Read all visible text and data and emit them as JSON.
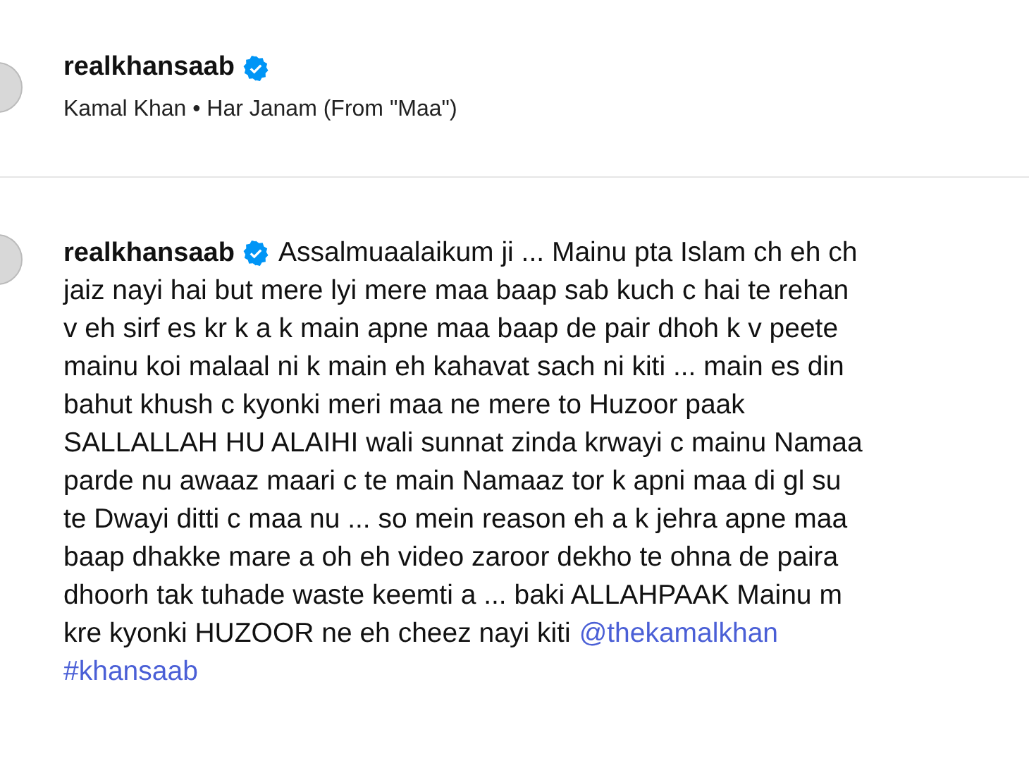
{
  "header": {
    "username": "realkhansaab",
    "verified": true,
    "audio": "Kamal Khan • Har Janam (From \"Maa\")"
  },
  "caption": {
    "username": "realkhansaab",
    "verified": true,
    "lines": [
      "Assalmuaalaikum ji ... Mainu pta Islam ch eh ch",
      "jaiz nayi hai but mere lyi mere maa baap sab kuch c hai te rehan",
      "v eh sirf es kr k a k main apne maa baap de pair dhoh k v peete",
      "mainu koi malaal ni k main eh kahavat sach ni kiti ... main es din",
      "bahut khush c kyonki meri maa ne mere to Huzoor paak",
      "SALLALLAH HU ALAIHI wali sunnat zinda krwayi c mainu Namaa",
      "parde nu awaaz maari c te main Namaaz tor k apni maa di gl su",
      "te Dwayi ditti c maa nu ... so mein reason eh a k jehra apne maa",
      "baap dhakke mare a oh eh video zaroor dekho te ohna de paira",
      "dhoorh tak tuhade waste keemti a ... baki ALLAHPAAK Mainu m",
      "kre kyonki HUZOOR ne eh cheez nayi kiti"
    ],
    "mention": "@thekamalkhan",
    "hashtag": "#khansaab"
  }
}
